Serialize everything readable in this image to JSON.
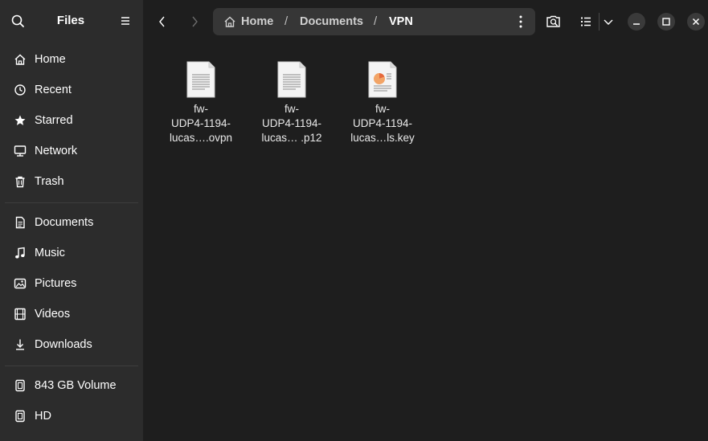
{
  "sidebar": {
    "title": "Files",
    "places": [
      {
        "label": "Home",
        "icon": "home-icon"
      },
      {
        "label": "Recent",
        "icon": "clock-icon"
      },
      {
        "label": "Starred",
        "icon": "star-icon"
      },
      {
        "label": "Network",
        "icon": "network-icon"
      },
      {
        "label": "Trash",
        "icon": "trash-icon"
      }
    ],
    "bookmarks": [
      {
        "label": "Documents",
        "icon": "document-icon"
      },
      {
        "label": "Music",
        "icon": "music-icon"
      },
      {
        "label": "Pictures",
        "icon": "picture-icon"
      },
      {
        "label": "Videos",
        "icon": "video-icon"
      },
      {
        "label": "Downloads",
        "icon": "download-icon"
      }
    ],
    "devices": [
      {
        "label": "843 GB Volume",
        "icon": "drive-icon"
      },
      {
        "label": "HD",
        "icon": "drive-icon"
      }
    ]
  },
  "pathbar": {
    "crumbs": [
      "Home",
      "Documents",
      "VPN"
    ],
    "separator": "/"
  },
  "files": [
    {
      "line1": "fw-",
      "line2": "UDP4-1194-",
      "line3": "lucas….ovpn",
      "icon": "text-file-icon"
    },
    {
      "line1": "fw-",
      "line2": "UDP4-1194-",
      "line3": "lucas…  .p12",
      "icon": "text-file-icon"
    },
    {
      "line1": "fw-",
      "line2": "UDP4-1194-",
      "line3": "lucas…ls.key",
      "icon": "key-file-icon"
    }
  ],
  "colors": {
    "sidebar_bg": "#2c2c2c",
    "content_bg": "#1e1e1e",
    "pathbar_bg": "#363636",
    "text": "#ffffff"
  }
}
